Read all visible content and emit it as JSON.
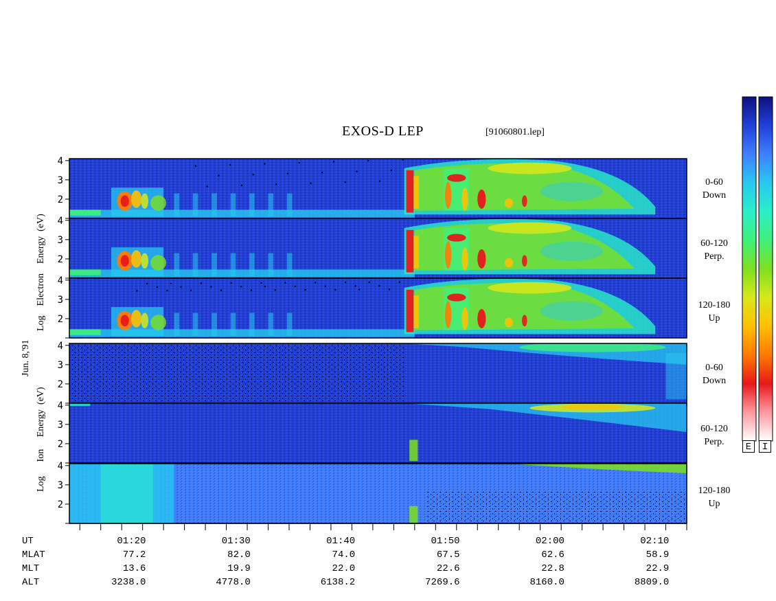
{
  "title": "EXOS-D LEP",
  "filename": "[91060801.lep]",
  "date_label": "Jun. 8,'91",
  "colors": {
    "scale": [
      "#10107f",
      "#2040d8",
      "#3f7fff",
      "#28c8f0",
      "#29f0c8",
      "#3ff07a",
      "#7ee020",
      "#d8e81a",
      "#ffc000",
      "#ff7a00",
      "#e8181a",
      "#ff9aa0",
      "#ffffff"
    ]
  },
  "colorbar_keys": [
    "E",
    "I"
  ],
  "electron": {
    "ylabel_words": [
      "Log",
      "Electron",
      "Energy",
      "(eV)"
    ],
    "panels": [
      {
        "label_top": "0-60",
        "label_bottom": "Down"
      },
      {
        "label_top": "60-120",
        "label_bottom": "Perp."
      },
      {
        "label_top": "120-180",
        "label_bottom": "Up"
      }
    ]
  },
  "ion": {
    "ylabel_words": [
      "Log",
      "Ion",
      "Energy",
      "(eV)"
    ],
    "panels": [
      {
        "label_top": "0-60",
        "label_bottom": "Down"
      },
      {
        "label_top": "60-120",
        "label_bottom": "Perp."
      },
      {
        "label_top": "120-180",
        "label_bottom": "Up"
      }
    ]
  },
  "orbit": {
    "row_labels": [
      "UT",
      "MLAT",
      "MLT",
      "ALT"
    ],
    "columns": [
      {
        "UT": "01:20",
        "MLAT": "77.2",
        "MLT": "13.6",
        "ALT": "3238.0"
      },
      {
        "UT": "01:30",
        "MLAT": "82.0",
        "MLT": "19.9",
        "ALT": "4778.0"
      },
      {
        "UT": "01:40",
        "MLAT": "74.0",
        "MLT": "22.0",
        "ALT": "6138.2"
      },
      {
        "UT": "01:50",
        "MLAT": "67.5",
        "MLT": "22.6",
        "ALT": "7269.6"
      },
      {
        "UT": "02:00",
        "MLAT": "62.6",
        "MLT": "22.8",
        "ALT": "8160.0"
      },
      {
        "UT": "02:10",
        "MLAT": "58.9",
        "MLT": "22.9",
        "ALT": "8809.0"
      }
    ]
  },
  "chart_data": {
    "type": "heatmap",
    "title": "EXOS-D LEP",
    "x_axis": {
      "label": "UT",
      "ticks": [
        "01:20",
        "01:30",
        "01:40",
        "01:50",
        "02:00",
        "02:10"
      ],
      "range_minutes_after_0100": [
        14,
        73
      ]
    },
    "y_axis": {
      "label": "Log Energy (eV)",
      "ticks": [
        2,
        3,
        4
      ],
      "range": [
        1.0,
        4.1
      ]
    },
    "species": [
      {
        "name": "Electron",
        "pitch_angle_bins": [
          "0-60 Down",
          "60-120 Perp.",
          "120-180 Up"
        ]
      },
      {
        "name": "Ion",
        "pitch_angle_bins": [
          "0-60 Down",
          "60-120 Perp.",
          "120-180 Up"
        ]
      }
    ],
    "colorbars": [
      "E",
      "I"
    ]
  }
}
